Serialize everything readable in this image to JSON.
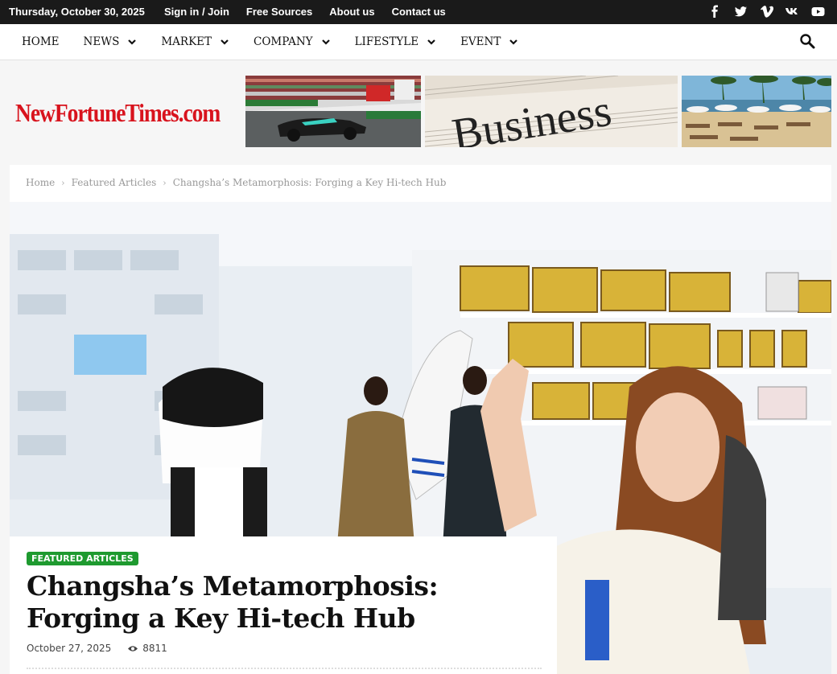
{
  "topbar": {
    "date": "Thursday, October 30, 2025",
    "links": [
      "Sign in / Join",
      "Free Sources",
      "About us",
      "Contact us"
    ],
    "social_icons": [
      "facebook-icon",
      "twitter-icon",
      "vimeo-icon",
      "vk-icon",
      "youtube-icon"
    ]
  },
  "nav": {
    "items": [
      {
        "label": "HOME",
        "has_dropdown": false
      },
      {
        "label": "NEWS",
        "has_dropdown": true
      },
      {
        "label": "MARKET",
        "has_dropdown": true
      },
      {
        "label": "COMPANY",
        "has_dropdown": true
      },
      {
        "label": "LIFESTYLE",
        "has_dropdown": true
      },
      {
        "label": "EVENT",
        "has_dropdown": true
      }
    ],
    "search_icon": "search-icon"
  },
  "header": {
    "logo_text": "NewFortuneTimes.com",
    "banners": [
      "race-car-banner",
      "business-newspaper-banner",
      "beach-resort-banner"
    ],
    "business_word": "Business"
  },
  "breadcrumb": [
    "Home",
    "Featured Articles",
    "Changsha’s Metamorphosis: Forging a Key Hi-tech Hub"
  ],
  "article": {
    "category": "FEATURED ARTICLES",
    "title": "Changsha’s Metamorphosis: Forging a Key Hi-tech Hub",
    "date": "October 27, 2025",
    "views": "8811"
  },
  "colors": {
    "topbar_bg": "#1a1a1a",
    "logo_red": "#d8131d",
    "badge_green": "#1e9a2f"
  }
}
